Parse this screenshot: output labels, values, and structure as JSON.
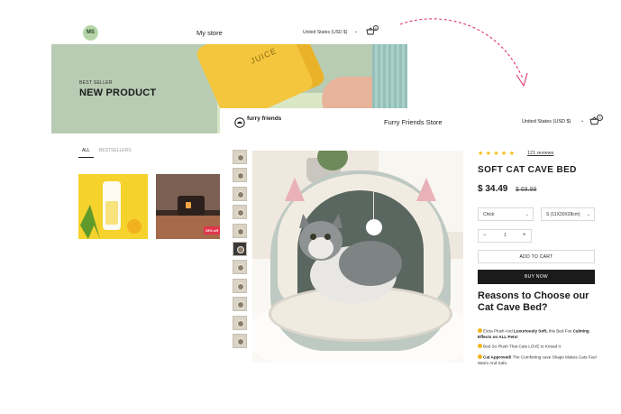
{
  "back_store": {
    "avatar_initials": "MS",
    "title": "My store",
    "currency": "United States (USD $)",
    "cart_count": "0",
    "hero": {
      "subtitle": "BEST SELLER",
      "title": "NEW PRODUCT",
      "bottle_text": "JUICE"
    },
    "tabs": [
      "ALL",
      "BESTSELLERS"
    ],
    "sale_badge": "15% off"
  },
  "front_store": {
    "logo_text": "furry friends",
    "title": "Furry Friends Store",
    "currency": "United States (USD $)",
    "cart_count": "0",
    "rating": {
      "stars": 5,
      "stars_text": "★★★★★",
      "reviews": "121 reviews"
    },
    "product": {
      "title": "SOFT CAT CAVE BED",
      "price": "$ 34.49",
      "compare_price": "$ 68.99",
      "color_option": "Chick",
      "size_option": "S (11X30X28cm)",
      "quantity": "1",
      "add_to_cart": "ADD TO CART",
      "buy_now": "BUY NOW"
    },
    "reasons": {
      "heading": "Reasons to Choose our Cat Cave Bed?",
      "b1_pre": "Extra Plush And ",
      "b1_bold1": "Luxuriously Soft,",
      "b1_mid": " this Bed Fos ",
      "b1_bold2": "Calming Effects on ALL Pets!",
      "b2": "Bed So Plush That Cats LOVE to Knead It",
      "b3_bold": "Cat Approved!",
      "b3_rest": " The Comforting cave Shape Makes Cats Feel Warm And Safe."
    }
  },
  "colors": {
    "hero_bg": "#b8ccb4",
    "star": "#f5b90a",
    "buy_button": "#1b1b1b",
    "arrow": "#e0356a"
  }
}
